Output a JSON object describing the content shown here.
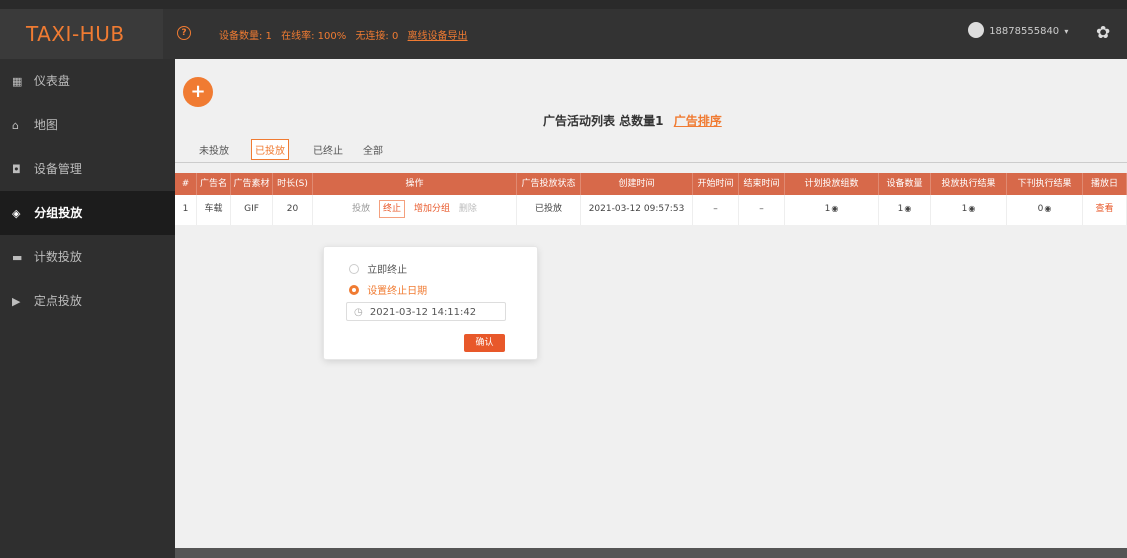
{
  "header": {
    "brand": "TAXI-HUB",
    "status": {
      "device_count": "设备数量: 1",
      "online_rate": "在线率: 100%",
      "no_connection": "无连接: 0",
      "export_link": "离线设备导出"
    },
    "user_phone": "18878555840"
  },
  "sidebar": {
    "items": [
      {
        "label": "仪表盘",
        "icon": "dashboard-icon"
      },
      {
        "label": "地图",
        "icon": "map-icon"
      },
      {
        "label": "设备管理",
        "icon": "car-icon"
      },
      {
        "label": "分组投放",
        "icon": "group-icon"
      },
      {
        "label": "计数投放",
        "icon": "counter-icon"
      },
      {
        "label": "定点投放",
        "icon": "play-icon"
      }
    ]
  },
  "main": {
    "add_button": "+",
    "list_title": "广告活动列表 总数量1",
    "rank_link": "广告排序",
    "tabs": [
      {
        "label": "未投放"
      },
      {
        "label": "已投放"
      },
      {
        "label": "已终止"
      },
      {
        "label": "全部"
      }
    ],
    "table": {
      "headers": [
        "#",
        "广告名",
        "广告素材",
        "时长(S)",
        "操作",
        "广告投放状态",
        "创建时间",
        "开始时间",
        "结束时间",
        "计划投放组数",
        "设备数量",
        "投放执行结果",
        "下刊执行结果",
        "播放日"
      ],
      "row": {
        "index": "1",
        "name": "车载",
        "material": "GIF",
        "duration": "20",
        "op_place": "投放",
        "op_stop": "终止",
        "op_add_group": "增加分组",
        "op_delete": "删除",
        "status": "已投放",
        "created": "2021-03-12 09:57:53",
        "start": "–",
        "end": "–",
        "plan_groups": "1",
        "devices": "1",
        "exec_result": "1",
        "off_result": "0",
        "view": "查看"
      }
    }
  },
  "popover": {
    "option_immediate": "立即终止",
    "option_set_date": "设置终止日期",
    "date_value": "2021-03-12 14:11:42",
    "confirm": "确认"
  },
  "colors": {
    "accent": "#f07b32",
    "header_row": "#d7694a"
  }
}
